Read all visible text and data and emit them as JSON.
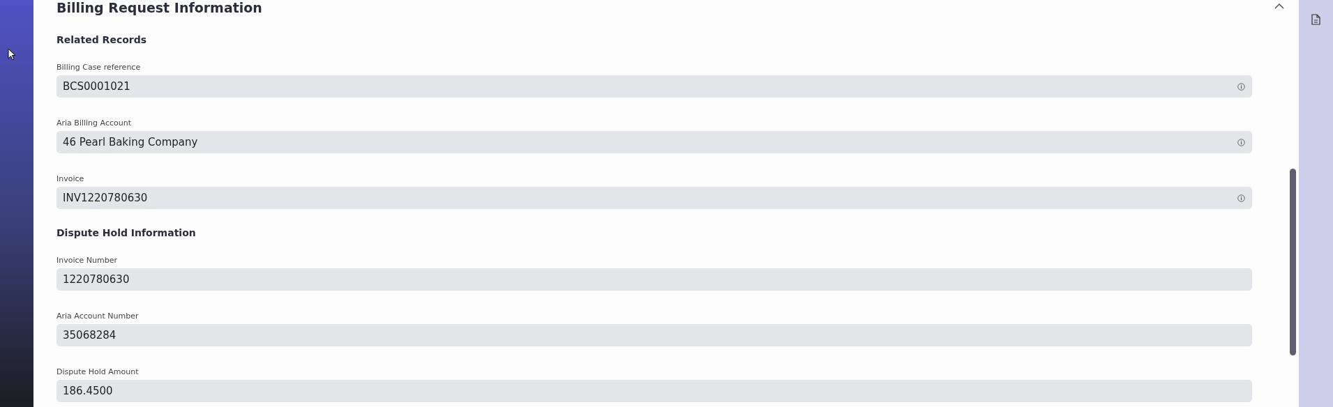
{
  "section": {
    "title": "Billing Request Information",
    "expanded": true
  },
  "groups": [
    {
      "heading": "Related Records",
      "fields": [
        {
          "label": "Billing Case reference",
          "value": "BCS0001021",
          "info": true
        },
        {
          "label": "Aria Billing Account",
          "value": "46 Pearl Baking Company",
          "info": true
        },
        {
          "label": "Invoice",
          "value": "INV1220780630",
          "info": true
        }
      ]
    },
    {
      "heading": "Dispute Hold Information",
      "fields": [
        {
          "label": "Invoice Number",
          "value": "1220780630",
          "info": false
        },
        {
          "label": "Aria Account Number",
          "value": "35068284",
          "info": false
        },
        {
          "label": "Dispute Hold Amount",
          "value": "186.4500",
          "info": false
        }
      ]
    }
  ]
}
